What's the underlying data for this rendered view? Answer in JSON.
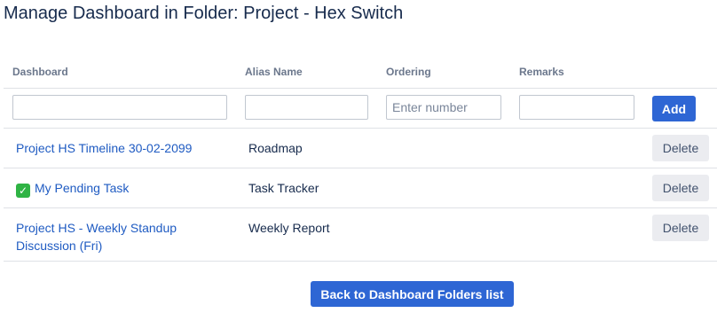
{
  "page": {
    "title": "Manage Dashboard in Folder: Project - Hex Switch",
    "back_label": "Back to Dashboard Folders list"
  },
  "table": {
    "headers": [
      "Dashboard",
      "Alias Name",
      "Ordering",
      "Remarks"
    ],
    "input_row": {
      "dashboard_value": "",
      "alias_value": "",
      "ordering_placeholder": "Enter number",
      "remarks_value": "",
      "add_label": "Add"
    },
    "rows": [
      {
        "dashboard": "Project HS Timeline 30-02-2099",
        "alias": "Roadmap",
        "delete_label": "Delete"
      },
      {
        "dashboard": "My Pending Task",
        "alias": "Task Tracker",
        "delete_label": "Delete",
        "icon": "check-mark-icon"
      },
      {
        "dashboard": "Project HS - Weekly Standup Discussion (Fri)",
        "alias": "Weekly Report",
        "delete_label": "Delete"
      }
    ]
  },
  "colors": {
    "primary": "#2e66d4",
    "link": "#1f5bc2",
    "check_green": "#2fb344",
    "header_text": "#6b778c"
  }
}
